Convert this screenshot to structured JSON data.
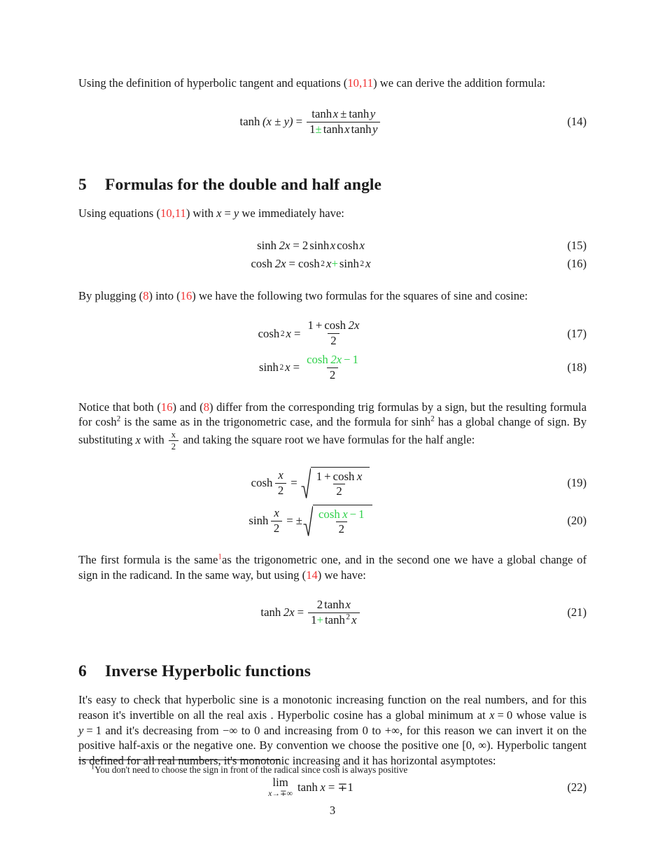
{
  "document": {
    "page_number": "3"
  },
  "paragraphs": {
    "intro_tanh_addition": {
      "part1": "Using the definition of hyperbolic tangent and equations (",
      "ref1": "10,11",
      "part2": ") we can derive the addition formula:"
    },
    "using_eq_10_11": {
      "part1": "Using equations (",
      "ref1": "10,11",
      "part2": ") with ",
      "math_inline": "x = y",
      "part3": " we immediately have:"
    },
    "by_plugging": {
      "part1": "By plugging (",
      "ref1": "8",
      "part2": ") into (",
      "ref2": "16",
      "part3": ") we have the following two formulas for the squares of sine and cosine:"
    },
    "notice_that_both": {
      "part1": "Notice that both (",
      "ref1": "16",
      "part2": ") and (",
      "ref2": "8",
      "part3": ") differ from the corresponding trig formulas by a sign, but the resulting formula for cosh",
      "sup1": "2",
      "part4": " is the same as in the trigonometric case, and the formula for sinh",
      "sup2": "2",
      "part5": " has a global change of sign. By substituting ",
      "math1": "x",
      "part6": " with ",
      "math2_num": "x",
      "math2_den": "2",
      "part7": " and taking the square root we have formulas for the half angle:"
    },
    "first_formula_same": {
      "part1": "The first formula is the same",
      "footnote_marker": "1",
      "part2": "as the trigonometric one,  and in the second one we have a global change of sign in the radicand. In the same way, but using (",
      "ref1": "14",
      "part2b": ") we have:"
    },
    "inverse_intro": {
      "part1": "It's easy to check that hyperbolic sine is a monotonic increasing function on the real numbers, and for this reason it's invertible on all the real axis . Hyperbolic cosine has a global minimum at ",
      "math1": "x = 0",
      "part2": " whose value is ",
      "math2": "y = 1",
      "part3": " and it's decreasing from ",
      "math3": "−∞",
      "part4": " to 0 and increasing from 0 to ",
      "math4": "+∞",
      "part5": ", for this reason we can invert it on the positive half-axis or the negative one. By convention we choose the positive one ",
      "math5": "[0, ∞)",
      "part6": ". Hyperbolic tangent is defined for all real numbers, it's monotonic increasing and it has horizontal asymptotes:"
    }
  },
  "sections": [
    {
      "number": "5",
      "title": "Formulas for the double and half angle"
    },
    {
      "number": "6",
      "title": "Inverse Hyperbolic functions"
    }
  ],
  "equations": {
    "eq14": {
      "number": "(14)",
      "lhs_fn": "tanh",
      "lhs_arg": "(x ± y)",
      "eq": "=",
      "num_fn1": "tanh",
      "num_var1": "x",
      "num_op": "±",
      "num_fn2": "tanh",
      "num_var2": "y",
      "den_one": "1",
      "den_op_green": "±",
      "den_fn1": "tanh",
      "den_var1": "x",
      "den_fn2": "tanh",
      "den_var2": "y"
    },
    "eq15": {
      "number": "(15)",
      "lhs_fn": "sinh",
      "lhs_arg": "2x",
      "eq": "=",
      "rhs_coef": "2",
      "rhs_fn1": "sinh",
      "rhs_var1": "x",
      "rhs_fn2": "cosh",
      "rhs_var2": "x"
    },
    "eq16": {
      "number": "(16)",
      "lhs_fn": "cosh",
      "lhs_arg": "2x",
      "eq": "=",
      "rhs_fn1": "cosh",
      "rhs_pow1": "2",
      "rhs_var1": "x",
      "rhs_op_green": "+",
      "rhs_fn2": "sinh",
      "rhs_pow2": "2",
      "rhs_var2": "x"
    },
    "eq17": {
      "number": "(17)",
      "lhs_fn": "cosh",
      "lhs_pow": "2",
      "lhs_var": "x",
      "eq": "=",
      "num_one": "1",
      "num_op": "+",
      "num_fn": "cosh",
      "num_arg": "2x",
      "den": "2"
    },
    "eq18": {
      "number": "(18)",
      "lhs_fn": "sinh",
      "lhs_pow": "2",
      "lhs_var": "x",
      "eq": "=",
      "num_fn_green": "cosh",
      "num_arg_green": "2x",
      "num_op_green": "−",
      "num_one_green": "1",
      "den": "2"
    },
    "eq19": {
      "number": "(19)",
      "lhs_fn": "cosh",
      "lhs_num": "x",
      "lhs_den": "2",
      "eq": "=",
      "rad_num_one": "1",
      "rad_num_op": "+",
      "rad_num_fn": "cosh",
      "rad_num_var": "x",
      "rad_den": "2"
    },
    "eq20": {
      "number": "(20)",
      "lhs_fn": "sinh",
      "lhs_num": "x",
      "lhs_den": "2",
      "eq": "=",
      "pm": "±",
      "rad_num_fn_green": "cosh",
      "rad_num_var_green": "x",
      "rad_num_op_green": "−",
      "rad_num_one_green": "1",
      "rad_den": "2"
    },
    "eq21": {
      "number": "(21)",
      "lhs_fn": "tanh",
      "lhs_arg": "2x",
      "eq": "=",
      "num_coef": "2",
      "num_fn": "tanh",
      "num_var": "x",
      "den_one": "1",
      "den_op_green": "+",
      "den_fn": "tanh",
      "den_pow": "2",
      "den_var": "x"
    },
    "eq22": {
      "number": "(22)",
      "lim_main": "lim",
      "lim_sub": "x→∓∞",
      "fn": "tanh",
      "var": "x",
      "eq": "=",
      "rhs": "∓1"
    }
  },
  "footnote": {
    "marker": "1",
    "text": "You don't need to choose the sign in front of the radical since cosh is always positive"
  },
  "colors": {
    "reference_red": "#f03232",
    "highlight_green": "#2fd14a",
    "text": "#1a1a1a"
  }
}
